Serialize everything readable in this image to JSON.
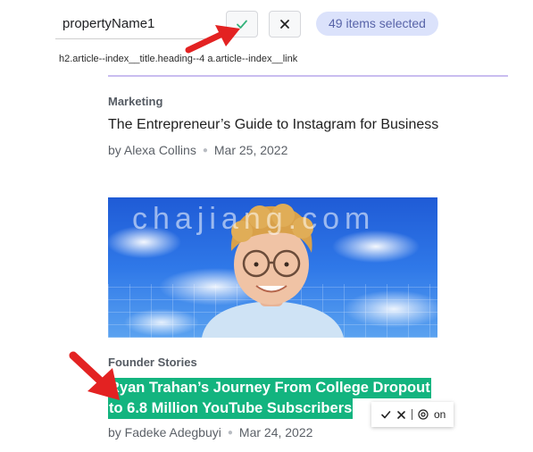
{
  "toolbar": {
    "property_name_value": "propertyName1",
    "confirm_icon": "check-icon",
    "cancel_icon": "close-icon",
    "selection_count": "49 items selected",
    "selector_path": "h2.article--index__title.heading--4 a.article--index__link",
    "confirm_color": "#34b27b",
    "pill_color": "#dbe2fb"
  },
  "articles": [
    {
      "category": "Marketing",
      "title": "The Entrepreneur’s Guide to Instagram for Business",
      "author": "by Alexa Collins",
      "date": "Mar 25, 2022"
    },
    {
      "category": "Founder Stories",
      "title_line1": "Ryan Trahan’s Journey From College Dropout",
      "title_line2": "to 6.8 Million YouTube Subscribers",
      "author": "by Fadeke Adegbuyi",
      "date": "Mar 24, 2022",
      "highlight_color": "#13b47f"
    }
  ],
  "watermark": "chajiang.com",
  "mini_toolbar": {
    "confirm_icon": "check-icon",
    "close_icon": "close-icon",
    "target_icon": "target-icon",
    "label": "on"
  },
  "annotation_color": "#e32222"
}
